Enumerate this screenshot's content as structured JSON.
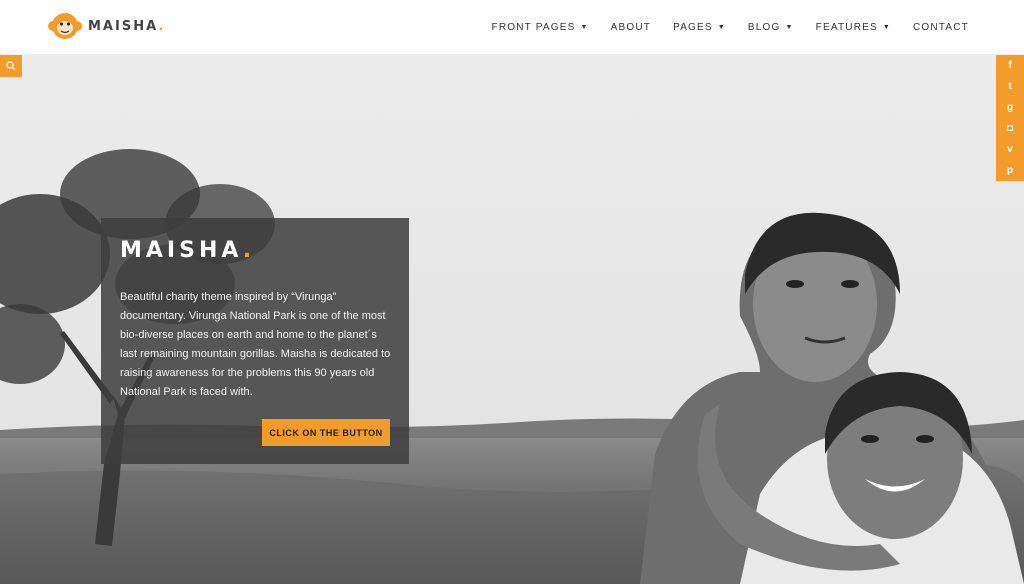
{
  "brand": {
    "name": "MAISHA",
    "dot": "."
  },
  "nav": [
    {
      "label": "FRONT PAGES",
      "dropdown": true
    },
    {
      "label": "ABOUT",
      "dropdown": false
    },
    {
      "label": "PAGES",
      "dropdown": true
    },
    {
      "label": "BLOG",
      "dropdown": true
    },
    {
      "label": "FEATURES",
      "dropdown": true
    },
    {
      "label": "CONTACT",
      "dropdown": false
    }
  ],
  "hero": {
    "title": "MAISHA",
    "title_dot": ".",
    "description": "Beautiful charity theme inspired by “Virunga” documentary. Virunga National Park is one of the most bio-diverse places on earth and home to the planet´s last remaining mountain gorillas. Maisha is dedicated to raising awareness for the problems this 90 years old National Park is faced with.",
    "button_label": "CLICK ON THE BUTTON"
  },
  "social": [
    {
      "icon": "facebook-icon",
      "glyph": "f"
    },
    {
      "icon": "twitter-icon",
      "glyph": "t"
    },
    {
      "icon": "google-plus-icon",
      "glyph": "g"
    },
    {
      "icon": "instagram-icon",
      "glyph": "◘"
    },
    {
      "icon": "vimeo-icon",
      "glyph": "v"
    },
    {
      "icon": "pinterest-icon",
      "glyph": "p"
    }
  ],
  "colors": {
    "accent": "#f39c2b",
    "card_bg": "#3e3e3e",
    "text_dark": "#333333"
  }
}
